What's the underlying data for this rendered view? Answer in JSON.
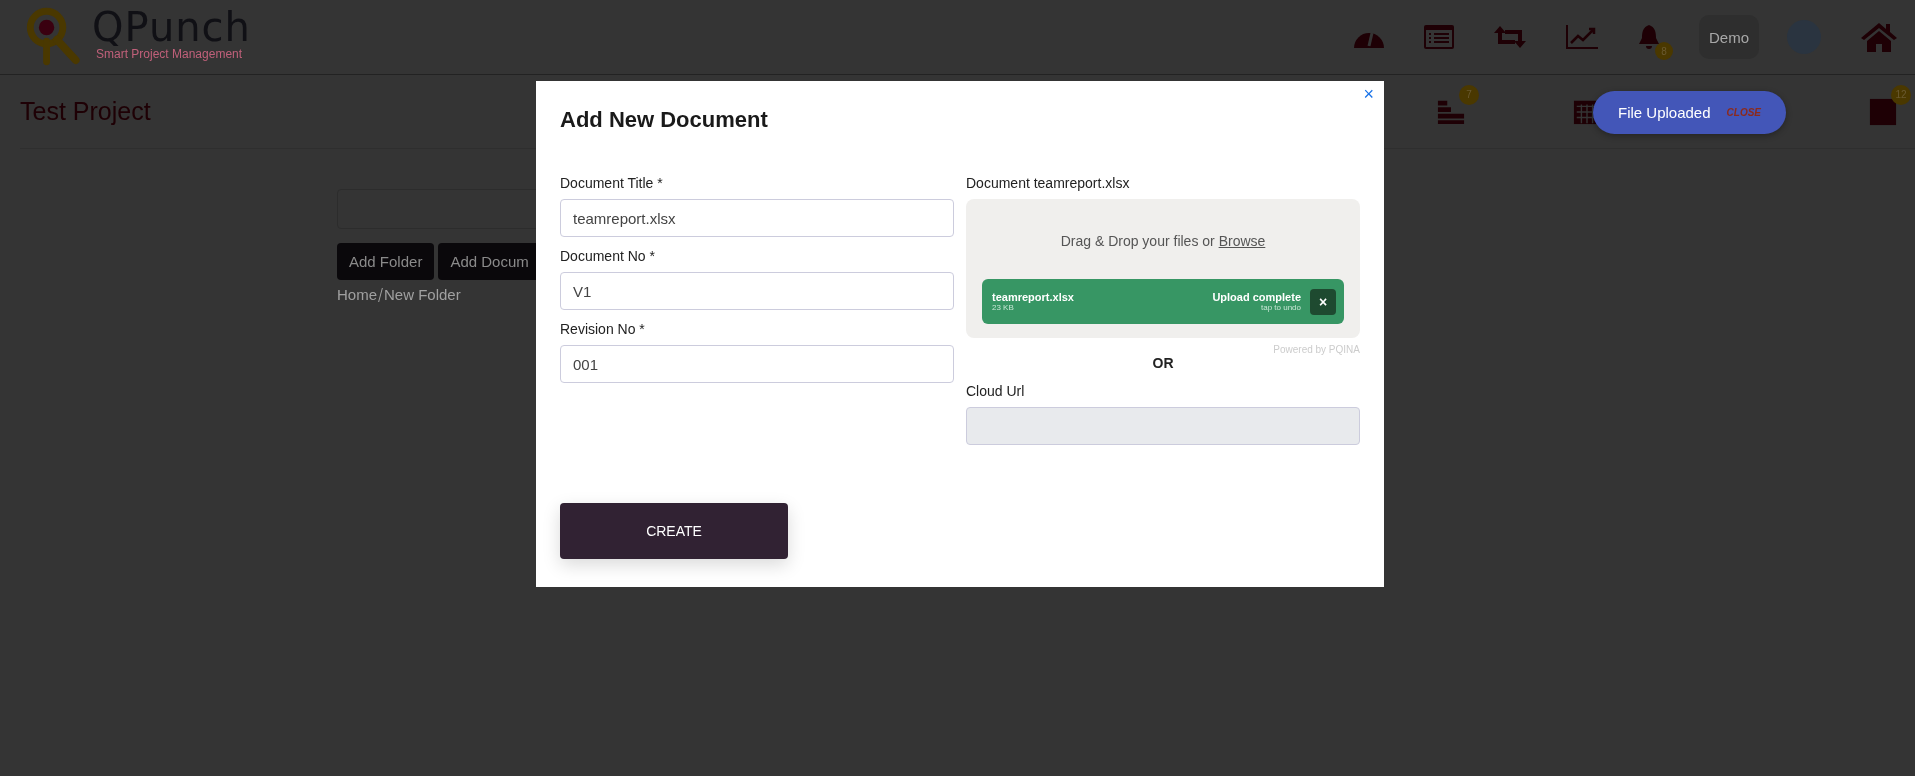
{
  "header": {
    "logo": {
      "name": "QPunch",
      "tagline": "Smart Project Management"
    },
    "nav_icons": [
      {
        "kind": "gauge"
      },
      {
        "kind": "list"
      },
      {
        "kind": "repeat"
      },
      {
        "kind": "chart"
      },
      {
        "kind": "bell",
        "badge": "8"
      },
      {
        "kind": "user",
        "label": "Demo"
      },
      {
        "kind": "avatar"
      },
      {
        "kind": "home"
      }
    ]
  },
  "project": {
    "title": "Test Project",
    "toolbar": [
      {
        "kind": "stack",
        "badge": "7"
      },
      {
        "kind": "calendar"
      },
      {
        "kind": "note",
        "badge": "12"
      }
    ]
  },
  "content": {
    "buttons": [
      "Add Folder",
      "Add Docum"
    ],
    "breadcrumb": [
      "Home",
      "New Folder"
    ]
  },
  "modal": {
    "title": "Add New Document",
    "close": "×",
    "fields": [
      {
        "label": "Document Title *",
        "value": "teamreport.xlsx"
      },
      {
        "label": "Document No *",
        "value": "V1"
      },
      {
        "label": "Revision No *",
        "value": "001"
      }
    ],
    "upload": {
      "label": "Document teamreport.xlsx",
      "prompt": "Drag & Drop your files or ",
      "browse": "Browse",
      "file": {
        "name": "teamreport.xlsx",
        "size": "23 KB",
        "status": "Upload complete",
        "hint": "tap to undo",
        "remove": "×"
      },
      "credit": "Powered by PQINA"
    },
    "separator": "OR",
    "cloud": {
      "label": "Cloud Url",
      "disabled": true
    },
    "submit": "CREATE"
  },
  "toast": {
    "message": "File Uploaded",
    "action": "CLOSE"
  }
}
